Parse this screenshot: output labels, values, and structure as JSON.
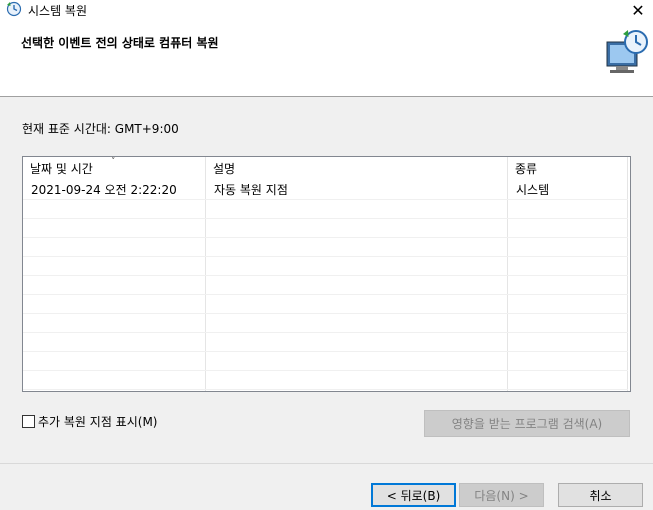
{
  "window": {
    "title": "시스템 복원",
    "close_glyph": "✕"
  },
  "header": {
    "title": "선택한 이벤트 전의 상태로 컴퓨터 복원"
  },
  "timezone_label": "현재 표준 시간대: GMT+9:00",
  "list": {
    "columns": [
      "날짜 및 시간",
      "설명",
      "종류"
    ],
    "sort_indicator": "˅",
    "rows": [
      [
        "2021-09-24 오전 2:22:20",
        "자동 복원 지점",
        "시스템"
      ]
    ]
  },
  "show_more_checkbox": {
    "label": "추가 복원 지점 표시(M)",
    "checked": false
  },
  "buttons": {
    "scan_affected": "영향을 받는 프로그램 검색(A)",
    "back": "< 뒤로(B)",
    "next": "다음(N) >",
    "cancel": "취소"
  },
  "colors": {
    "accent": "#0078d7",
    "disabled_text": "#838383"
  }
}
